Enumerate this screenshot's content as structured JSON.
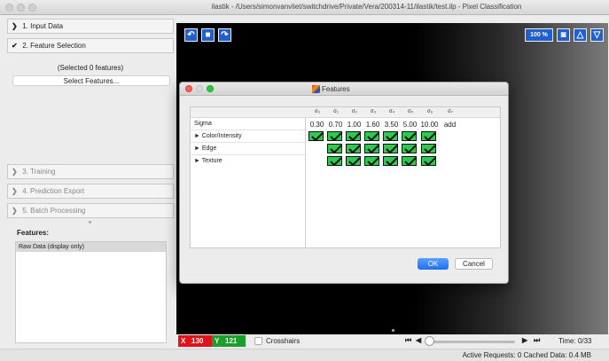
{
  "window": {
    "title": "ilastik - /Users/simonvanvliet/switchdrive/Private/Vera/200314-11/ilastik/test.ilp - Pixel Classification"
  },
  "applets": {
    "input_data": "1. Input Data",
    "feature_selection": "2. Feature Selection",
    "selected_count": "(Selected 0 features)",
    "select_features_button": "Select Features...",
    "training": "3. Training",
    "prediction_export": "4. Prediction Export",
    "batch_processing": "5. Batch Processing"
  },
  "features_panel": {
    "label": "Features:",
    "items": [
      "Raw Data (display only)"
    ]
  },
  "viewer_toolbar": {
    "zoom": "100 %",
    "icons": [
      "rotate-left-icon",
      "stop-icon",
      "rotate-right-icon",
      "camera-icon",
      "triangle-up-icon",
      "triangle-down-icon"
    ]
  },
  "viewer_status": {
    "x_label": "X",
    "x_value": "130",
    "y_label": "Y",
    "y_value": "121",
    "crosshairs": "Crosshairs",
    "time": "Time: 0/33"
  },
  "statusbar": {
    "text": "Active Requests: 0  Cached Data: 0.4 MB"
  },
  "dialog": {
    "title": "Features",
    "columns": [
      "σ₀",
      "σ₁",
      "σ₂",
      "σ₃",
      "σ₄",
      "σ₅",
      "σ₆",
      "σ₇"
    ],
    "sigma_label": "Sigma",
    "sigma_values": [
      "0.30",
      "0.70",
      "1.00",
      "1.60",
      "3.50",
      "5.00",
      "10.00",
      "add"
    ],
    "rows": [
      {
        "label": "► Color/Intensity",
        "checked": [
          true,
          true,
          true,
          true,
          true,
          true,
          true
        ]
      },
      {
        "label": "► Edge",
        "checked": [
          false,
          true,
          true,
          true,
          true,
          true,
          true
        ]
      },
      {
        "label": "► Texture",
        "checked": [
          false,
          true,
          true,
          true,
          true,
          true,
          true
        ]
      }
    ],
    "ok": "OK",
    "cancel": "Cancel",
    "colors": {
      "checkbox": "#2ccb4e",
      "ok": "#1f6ff0"
    }
  }
}
